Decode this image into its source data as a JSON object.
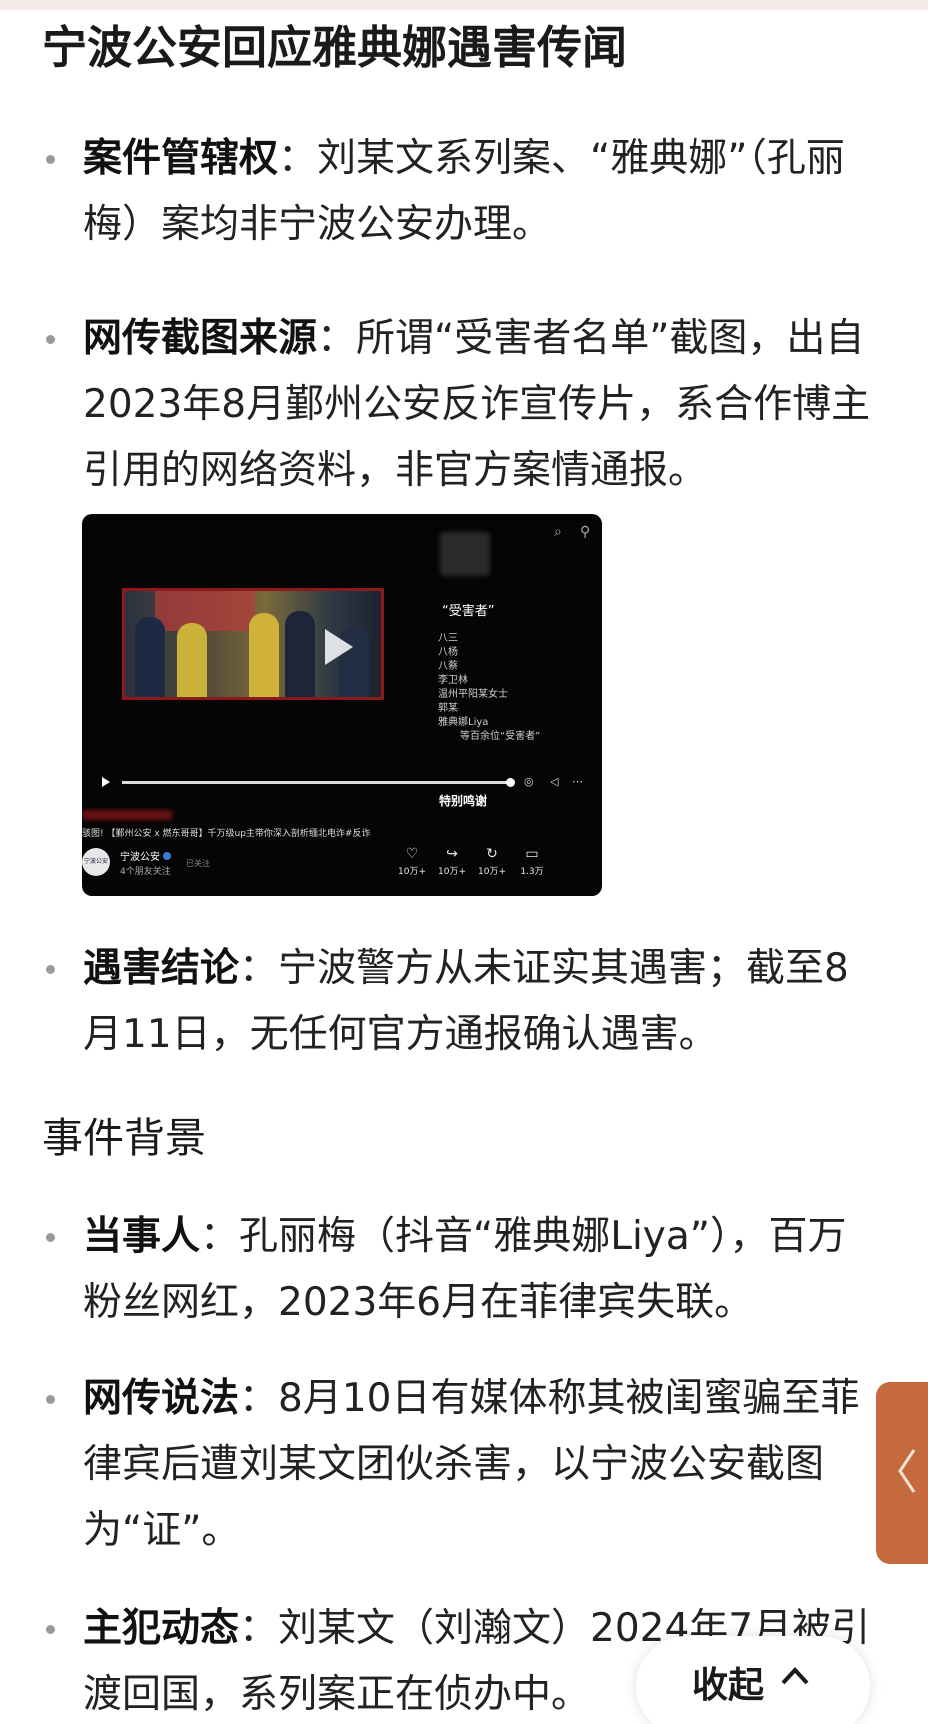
{
  "page": {
    "title": "宁波公安回应雅典娜遇害传闻",
    "section_heading": "事件背景",
    "collapse_label": "收起"
  },
  "bullets": [
    {
      "label": "案件管辖权",
      "text": "：刘某文系列案、“雅典娜”（孔丽梅）案均非宁波公安办理。"
    },
    {
      "label": "网传截图来源",
      "text": "：所谓“受害者名单”截图，出自2023年8月鄞州公安反诈宣传片，系合作博主引用的网络资料，非官方案情通报。"
    },
    {
      "label": "遇害结论",
      "text": "：宁波警方从未证实其遇害；截至8月11日，无任何官方通报确认遇害。"
    }
  ],
  "background_bullets": [
    {
      "label": "当事人",
      "text": "：孔丽梅（抖音“雅典娜Liya”），百万粉丝网红，2023年6月在菲律宾失联。"
    },
    {
      "label": "网传说法",
      "text": "：8月10日有媒体称其被闺蜜骗至菲律宾后遭刘某文团伙杀害，以宁波公安截图为“证”。"
    },
    {
      "label": "主犯动态",
      "text": "：刘某文（刘瀚文）2024年7月被引渡回国，系列案正在侦办中。"
    }
  ],
  "video": {
    "heading": "“受害者”",
    "list": [
      "八三",
      "八杨",
      "八蔡",
      "李卫林",
      "温州平阳某女士",
      "郭某",
      "雅典娜Liya",
      "等百余位“受害者”"
    ],
    "thanks": "特别鸣谢",
    "caption": "骇图! 【鄞州公安 x 燃东哥哥】千万级up主带你深入剖析缅北电诈#反诈",
    "account": "宁波公安",
    "followers": "4个朋友关注",
    "followed": "已关注",
    "avatar_text": "宁波公安",
    "actions": [
      {
        "icon": "like-icon",
        "count": "10万+"
      },
      {
        "icon": "share-icon",
        "count": "10万+"
      },
      {
        "icon": "recommend-icon",
        "count": "10万+"
      },
      {
        "icon": "comment-icon",
        "count": "1.3万"
      }
    ]
  },
  "colors": {
    "side_tab": "#c46a3e",
    "top_strip": "#f6e9ea"
  }
}
